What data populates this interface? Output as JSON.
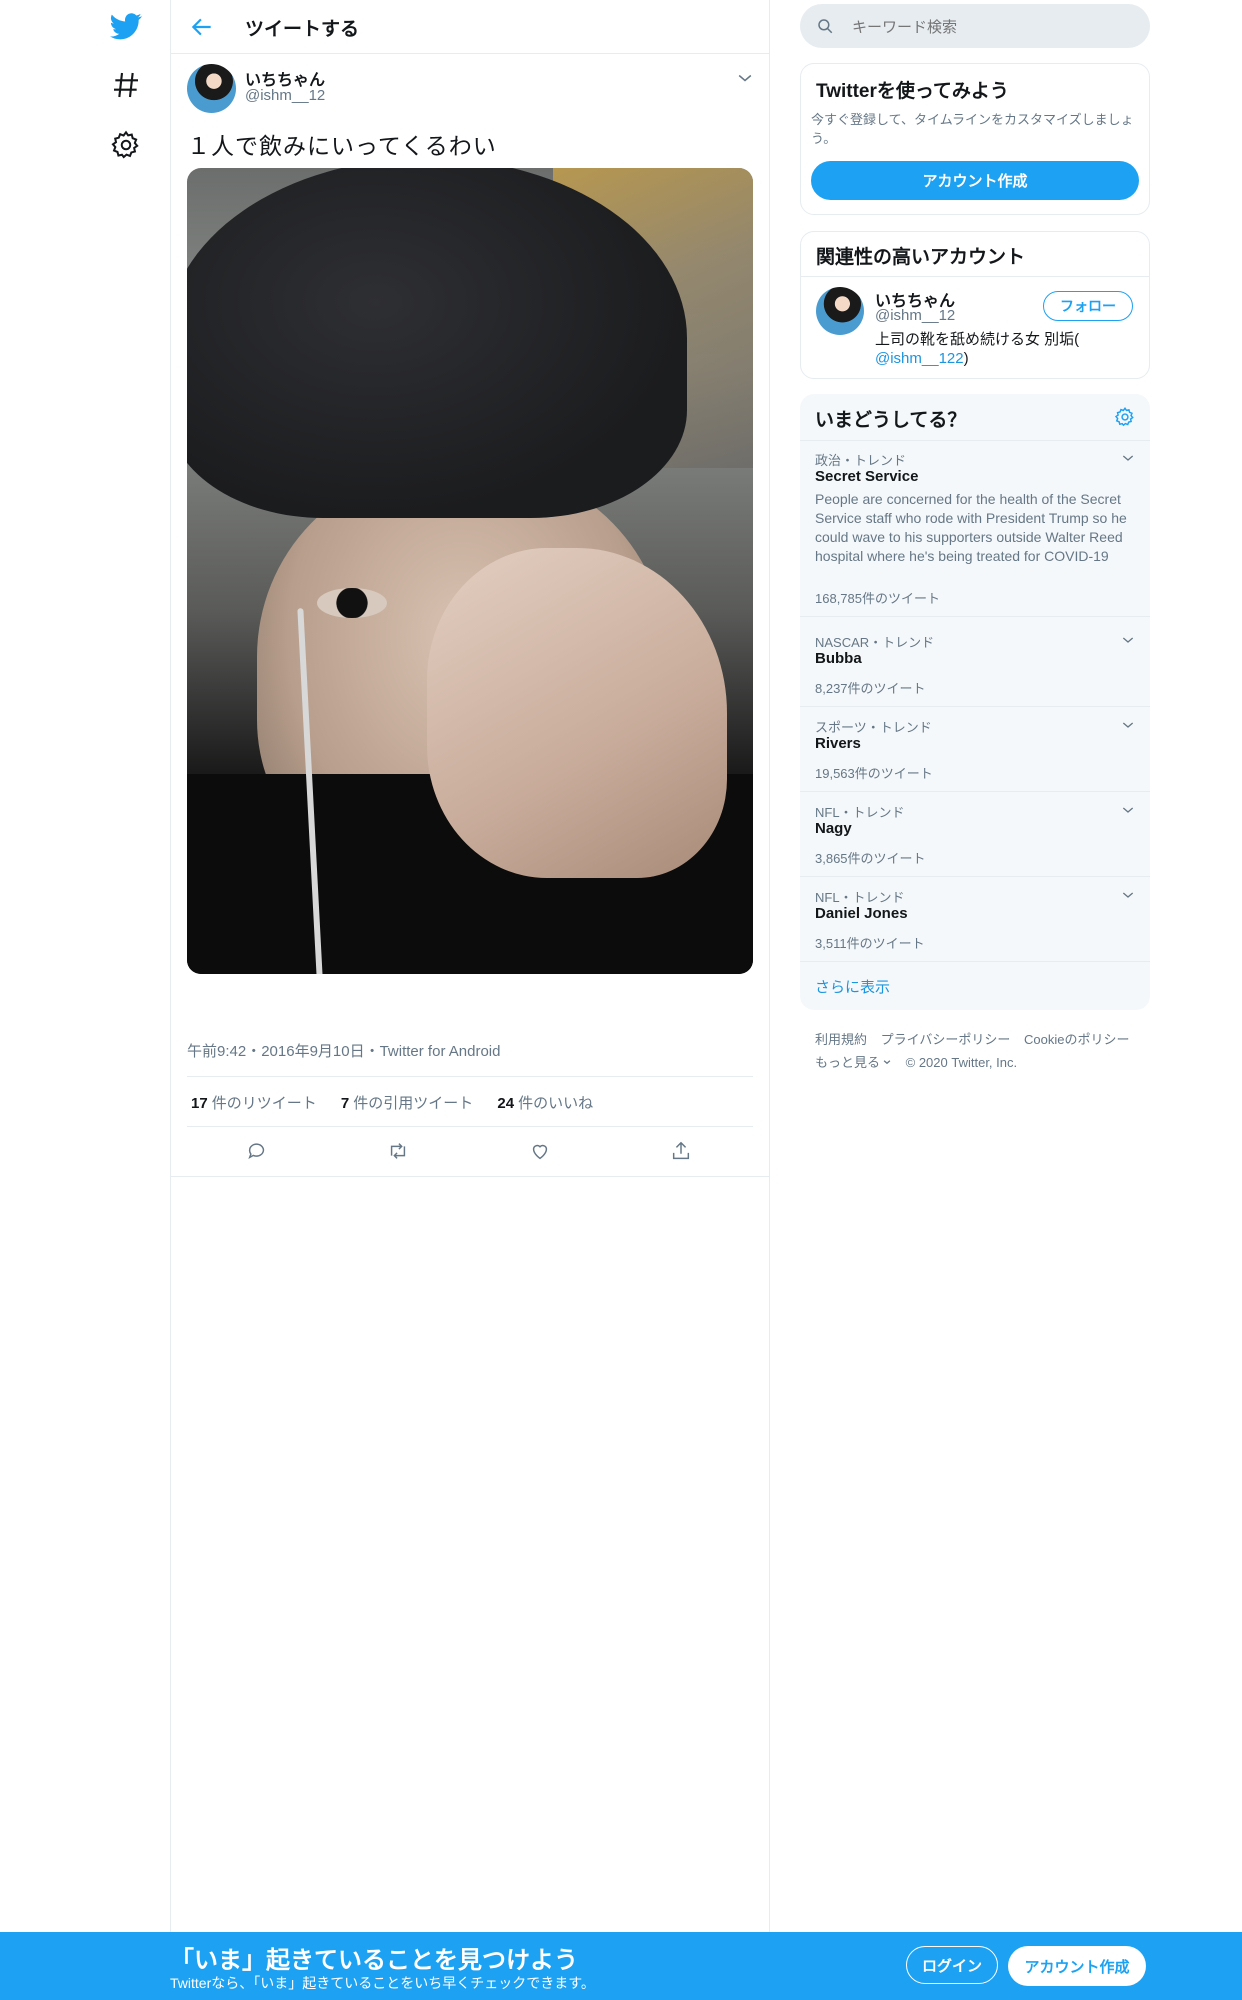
{
  "colors": {
    "accent": "#1da1f2",
    "link": "#1b95e0",
    "muted": "#657786",
    "text": "#14171a",
    "border": "#e6ecf0"
  },
  "nav": {
    "icons": [
      "twitter-bird-icon",
      "hashtag-icon",
      "gear-icon"
    ]
  },
  "header": {
    "title": "ツイートする"
  },
  "tweet": {
    "author_name": "いちちゃん",
    "author_handle": "@ishm__12",
    "text": "１人で飲みにいってくるわい",
    "timestamp": "午前9:42・2016年9月10日・Twitter for Android",
    "stats": [
      {
        "count": "17",
        "label": "件のリツイート"
      },
      {
        "count": "7",
        "label": "件の引用ツイート"
      },
      {
        "count": "24",
        "label": "件のいいね"
      }
    ]
  },
  "search": {
    "placeholder": "キーワード検索"
  },
  "signup_card": {
    "title": "Twitterを使ってみよう",
    "desc": "今すぐ登録して、タイムラインをカスタマイズしましょう。",
    "button": "アカウント作成"
  },
  "related": {
    "title": "関連性の高いアカウント",
    "name": "いちちゃん",
    "handle": "@ishm__12",
    "follow": "フォロー",
    "bio_text": "上司の靴を舐め続ける女 別垢(",
    "bio_link": "@ishm__122",
    "bio_close": ")"
  },
  "trends": {
    "title": "いまどうしてる？",
    "items": [
      {
        "category": "政治・トレンド",
        "name": "Secret Service",
        "desc": "People are concerned for the health of the Secret Service staff who rode with President Trump so he could wave to his supporters outside Walter Reed hospital where he's being treated for COVID-19",
        "count": "168,785件のツイート"
      },
      {
        "category": "NASCAR・トレンド",
        "name": "Bubba",
        "desc": "",
        "count": "8,237件のツイート"
      },
      {
        "category": "スポーツ・トレンド",
        "name": "Rivers",
        "desc": "",
        "count": "19,563件のツイート"
      },
      {
        "category": "NFL・トレンド",
        "name": "Nagy",
        "desc": "",
        "count": "3,865件のツイート"
      },
      {
        "category": "NFL・トレンド",
        "name": "Daniel Jones",
        "desc": "",
        "count": "3,511件のツイート"
      }
    ],
    "more": "さらに表示"
  },
  "footer": {
    "links": [
      "利用規約",
      "プライバシーポリシー",
      "Cookieのポリシー"
    ],
    "more": "もっと見る",
    "copyright": "© 2020 Twitter, Inc."
  },
  "banner": {
    "headline": "「いま」起きていることを見つけよう",
    "sub": "Twitterなら、「いま」起きていることをいち早くチェックできます。",
    "login": "ログイン",
    "signup": "アカウント作成"
  }
}
